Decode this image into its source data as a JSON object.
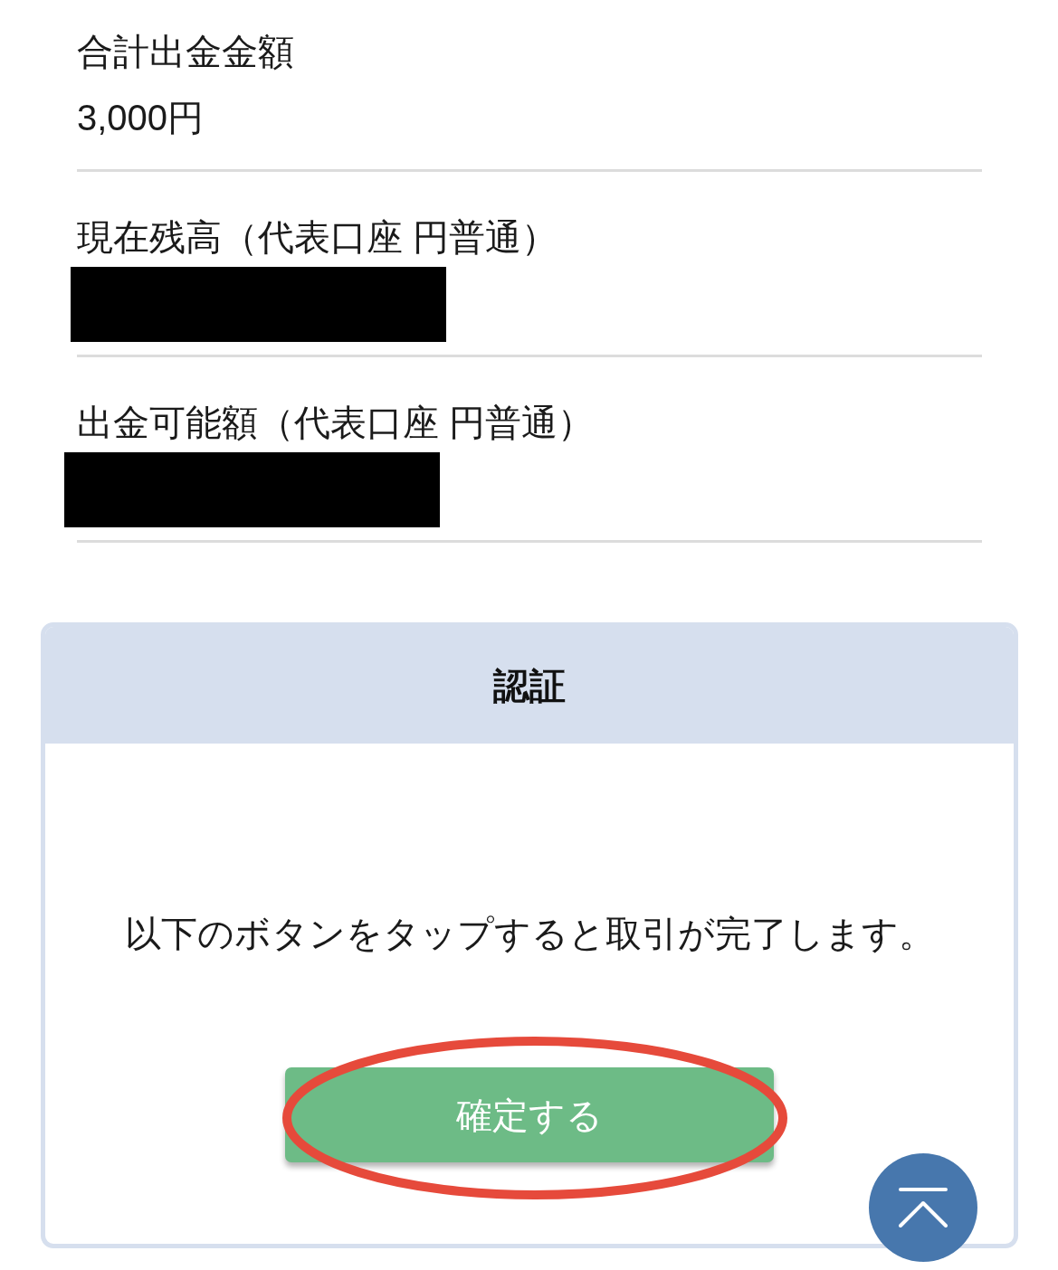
{
  "summary_fields": [
    {
      "label": "合計出金金額",
      "value": "3,000円",
      "redacted": false
    },
    {
      "label": "現在残高（代表口座 円普通）",
      "redacted": true
    },
    {
      "label": "出金可能額（代表口座 円普通）",
      "redacted": true
    }
  ],
  "auth_panel": {
    "title": "認証",
    "message": "以下のボタンをタップすると取引が完了します。",
    "confirm_button": {
      "label": "確定する",
      "circled": true
    }
  }
}
